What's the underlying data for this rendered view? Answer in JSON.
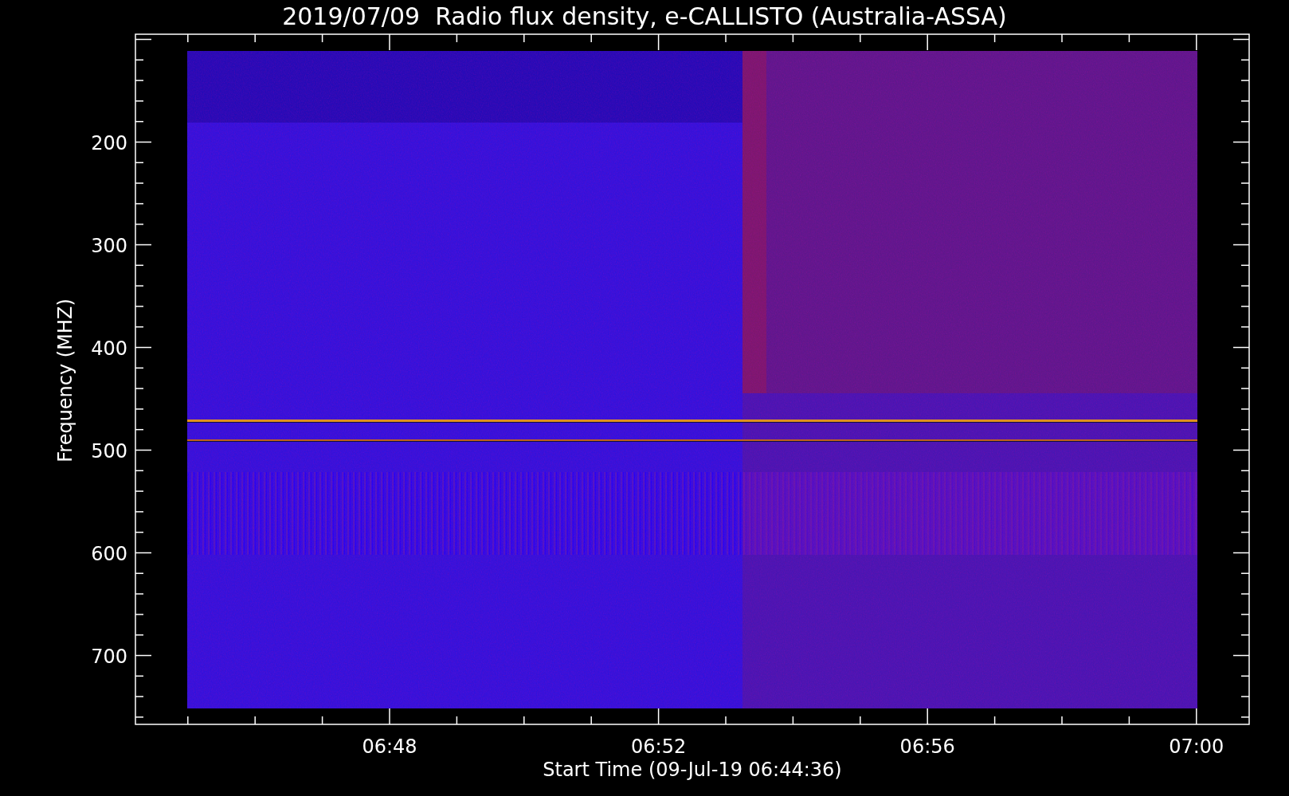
{
  "title": "2019/07/09  Radio flux density, e-CALLISTO (Australia-ASSA)",
  "y_axis": {
    "label": "Frequency (MHZ)",
    "tick_labels": [
      "200",
      "300",
      "400",
      "500",
      "600",
      "700"
    ]
  },
  "x_axis": {
    "label": "Start Time (09-Jul-19 06:44:36)",
    "tick_labels": [
      "06:48",
      "06:52",
      "06:56",
      "07:00"
    ]
  }
}
